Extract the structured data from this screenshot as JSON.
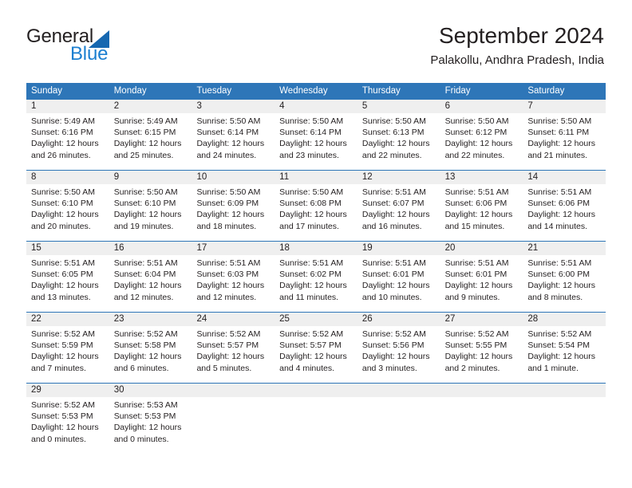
{
  "brand": {
    "name_part1": "General",
    "name_part2": "Blue",
    "triangle_icon": "triangle-icon",
    "accent_color": "#1667b0",
    "blue_text_color": "#1c7fd0"
  },
  "header": {
    "title": "September 2024",
    "subtitle": "Palakollu, Andhra Pradesh, India"
  },
  "theme": {
    "header_bar_color": "#2e76b8",
    "date_band_color": "#efefef",
    "text_color": "#231f20"
  },
  "weekdays": [
    "Sunday",
    "Monday",
    "Tuesday",
    "Wednesday",
    "Thursday",
    "Friday",
    "Saturday"
  ],
  "weeks": [
    {
      "days": [
        {
          "date": "1",
          "sunrise": "Sunrise: 5:49 AM",
          "sunset": "Sunset: 6:16 PM",
          "daylight_line1": "Daylight: 12 hours",
          "daylight_line2": "and 26 minutes."
        },
        {
          "date": "2",
          "sunrise": "Sunrise: 5:49 AM",
          "sunset": "Sunset: 6:15 PM",
          "daylight_line1": "Daylight: 12 hours",
          "daylight_line2": "and 25 minutes."
        },
        {
          "date": "3",
          "sunrise": "Sunrise: 5:50 AM",
          "sunset": "Sunset: 6:14 PM",
          "daylight_line1": "Daylight: 12 hours",
          "daylight_line2": "and 24 minutes."
        },
        {
          "date": "4",
          "sunrise": "Sunrise: 5:50 AM",
          "sunset": "Sunset: 6:14 PM",
          "daylight_line1": "Daylight: 12 hours",
          "daylight_line2": "and 23 minutes."
        },
        {
          "date": "5",
          "sunrise": "Sunrise: 5:50 AM",
          "sunset": "Sunset: 6:13 PM",
          "daylight_line1": "Daylight: 12 hours",
          "daylight_line2": "and 22 minutes."
        },
        {
          "date": "6",
          "sunrise": "Sunrise: 5:50 AM",
          "sunset": "Sunset: 6:12 PM",
          "daylight_line1": "Daylight: 12 hours",
          "daylight_line2": "and 22 minutes."
        },
        {
          "date": "7",
          "sunrise": "Sunrise: 5:50 AM",
          "sunset": "Sunset: 6:11 PM",
          "daylight_line1": "Daylight: 12 hours",
          "daylight_line2": "and 21 minutes."
        }
      ]
    },
    {
      "days": [
        {
          "date": "8",
          "sunrise": "Sunrise: 5:50 AM",
          "sunset": "Sunset: 6:10 PM",
          "daylight_line1": "Daylight: 12 hours",
          "daylight_line2": "and 20 minutes."
        },
        {
          "date": "9",
          "sunrise": "Sunrise: 5:50 AM",
          "sunset": "Sunset: 6:10 PM",
          "daylight_line1": "Daylight: 12 hours",
          "daylight_line2": "and 19 minutes."
        },
        {
          "date": "10",
          "sunrise": "Sunrise: 5:50 AM",
          "sunset": "Sunset: 6:09 PM",
          "daylight_line1": "Daylight: 12 hours",
          "daylight_line2": "and 18 minutes."
        },
        {
          "date": "11",
          "sunrise": "Sunrise: 5:50 AM",
          "sunset": "Sunset: 6:08 PM",
          "daylight_line1": "Daylight: 12 hours",
          "daylight_line2": "and 17 minutes."
        },
        {
          "date": "12",
          "sunrise": "Sunrise: 5:51 AM",
          "sunset": "Sunset: 6:07 PM",
          "daylight_line1": "Daylight: 12 hours",
          "daylight_line2": "and 16 minutes."
        },
        {
          "date": "13",
          "sunrise": "Sunrise: 5:51 AM",
          "sunset": "Sunset: 6:06 PM",
          "daylight_line1": "Daylight: 12 hours",
          "daylight_line2": "and 15 minutes."
        },
        {
          "date": "14",
          "sunrise": "Sunrise: 5:51 AM",
          "sunset": "Sunset: 6:06 PM",
          "daylight_line1": "Daylight: 12 hours",
          "daylight_line2": "and 14 minutes."
        }
      ]
    },
    {
      "days": [
        {
          "date": "15",
          "sunrise": "Sunrise: 5:51 AM",
          "sunset": "Sunset: 6:05 PM",
          "daylight_line1": "Daylight: 12 hours",
          "daylight_line2": "and 13 minutes."
        },
        {
          "date": "16",
          "sunrise": "Sunrise: 5:51 AM",
          "sunset": "Sunset: 6:04 PM",
          "daylight_line1": "Daylight: 12 hours",
          "daylight_line2": "and 12 minutes."
        },
        {
          "date": "17",
          "sunrise": "Sunrise: 5:51 AM",
          "sunset": "Sunset: 6:03 PM",
          "daylight_line1": "Daylight: 12 hours",
          "daylight_line2": "and 12 minutes."
        },
        {
          "date": "18",
          "sunrise": "Sunrise: 5:51 AM",
          "sunset": "Sunset: 6:02 PM",
          "daylight_line1": "Daylight: 12 hours",
          "daylight_line2": "and 11 minutes."
        },
        {
          "date": "19",
          "sunrise": "Sunrise: 5:51 AM",
          "sunset": "Sunset: 6:01 PM",
          "daylight_line1": "Daylight: 12 hours",
          "daylight_line2": "and 10 minutes."
        },
        {
          "date": "20",
          "sunrise": "Sunrise: 5:51 AM",
          "sunset": "Sunset: 6:01 PM",
          "daylight_line1": "Daylight: 12 hours",
          "daylight_line2": "and 9 minutes."
        },
        {
          "date": "21",
          "sunrise": "Sunrise: 5:51 AM",
          "sunset": "Sunset: 6:00 PM",
          "daylight_line1": "Daylight: 12 hours",
          "daylight_line2": "and 8 minutes."
        }
      ]
    },
    {
      "days": [
        {
          "date": "22",
          "sunrise": "Sunrise: 5:52 AM",
          "sunset": "Sunset: 5:59 PM",
          "daylight_line1": "Daylight: 12 hours",
          "daylight_line2": "and 7 minutes."
        },
        {
          "date": "23",
          "sunrise": "Sunrise: 5:52 AM",
          "sunset": "Sunset: 5:58 PM",
          "daylight_line1": "Daylight: 12 hours",
          "daylight_line2": "and 6 minutes."
        },
        {
          "date": "24",
          "sunrise": "Sunrise: 5:52 AM",
          "sunset": "Sunset: 5:57 PM",
          "daylight_line1": "Daylight: 12 hours",
          "daylight_line2": "and 5 minutes."
        },
        {
          "date": "25",
          "sunrise": "Sunrise: 5:52 AM",
          "sunset": "Sunset: 5:57 PM",
          "daylight_line1": "Daylight: 12 hours",
          "daylight_line2": "and 4 minutes."
        },
        {
          "date": "26",
          "sunrise": "Sunrise: 5:52 AM",
          "sunset": "Sunset: 5:56 PM",
          "daylight_line1": "Daylight: 12 hours",
          "daylight_line2": "and 3 minutes."
        },
        {
          "date": "27",
          "sunrise": "Sunrise: 5:52 AM",
          "sunset": "Sunset: 5:55 PM",
          "daylight_line1": "Daylight: 12 hours",
          "daylight_line2": "and 2 minutes."
        },
        {
          "date": "28",
          "sunrise": "Sunrise: 5:52 AM",
          "sunset": "Sunset: 5:54 PM",
          "daylight_line1": "Daylight: 12 hours",
          "daylight_line2": "and 1 minute."
        }
      ]
    },
    {
      "days": [
        {
          "date": "29",
          "sunrise": "Sunrise: 5:52 AM",
          "sunset": "Sunset: 5:53 PM",
          "daylight_line1": "Daylight: 12 hours",
          "daylight_line2": "and 0 minutes."
        },
        {
          "date": "30",
          "sunrise": "Sunrise: 5:53 AM",
          "sunset": "Sunset: 5:53 PM",
          "daylight_line1": "Daylight: 12 hours",
          "daylight_line2": "and 0 minutes."
        },
        {
          "date": "",
          "sunrise": "",
          "sunset": "",
          "daylight_line1": "",
          "daylight_line2": ""
        },
        {
          "date": "",
          "sunrise": "",
          "sunset": "",
          "daylight_line1": "",
          "daylight_line2": ""
        },
        {
          "date": "",
          "sunrise": "",
          "sunset": "",
          "daylight_line1": "",
          "daylight_line2": ""
        },
        {
          "date": "",
          "sunrise": "",
          "sunset": "",
          "daylight_line1": "",
          "daylight_line2": ""
        },
        {
          "date": "",
          "sunrise": "",
          "sunset": "",
          "daylight_line1": "",
          "daylight_line2": ""
        }
      ]
    }
  ]
}
